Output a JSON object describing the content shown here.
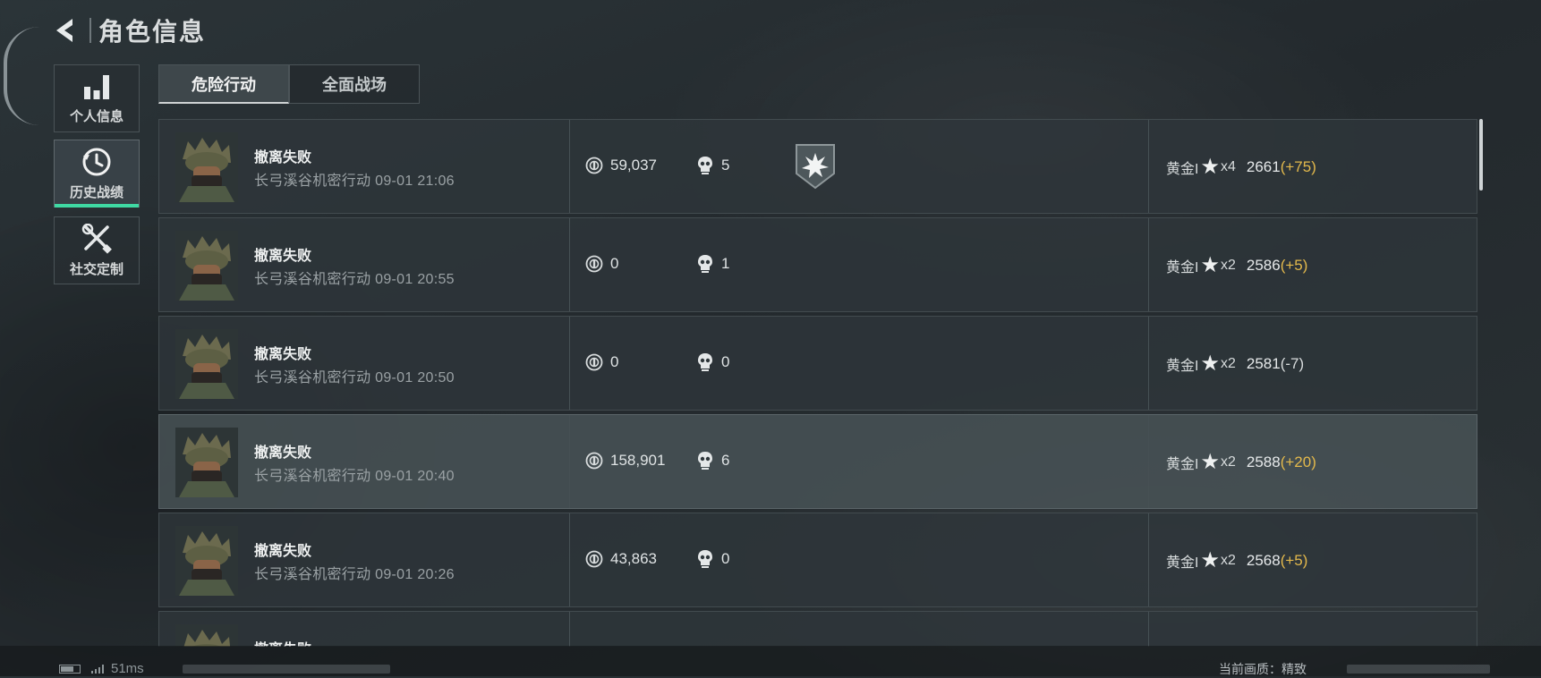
{
  "header": {
    "title": "角色信息"
  },
  "sidebar": {
    "items": [
      {
        "label": "个人信息",
        "icon": "bar-chart-icon"
      },
      {
        "label": "历史战绩",
        "icon": "history-clock-icon",
        "active": true
      },
      {
        "label": "社交定制",
        "icon": "tools-icon"
      }
    ]
  },
  "tabs": [
    {
      "label": "危险行动",
      "active": true
    },
    {
      "label": "全面战场",
      "active": false
    }
  ],
  "matches": [
    {
      "result": "撤离失败",
      "detail": "长弓溪谷机密行动 09-01 21:06",
      "coins": "59,037",
      "kills": "5",
      "badge": "explosion-shield-icon",
      "rank": "黄金I",
      "stars": "x4",
      "score": "2661",
      "delta": "(+75)",
      "delta_color": "#e3b94c"
    },
    {
      "result": "撤离失败",
      "detail": "长弓溪谷机密行动 09-01 20:55",
      "coins": "0",
      "kills": "1",
      "rank": "黄金I",
      "stars": "x2",
      "score": "2586",
      "delta": "(+5)",
      "delta_color": "#e3b94c"
    },
    {
      "result": "撤离失败",
      "detail": "长弓溪谷机密行动 09-01 20:50",
      "coins": "0",
      "kills": "0",
      "rank": "黄金I",
      "stars": "x2",
      "score": "2581",
      "delta": "(-7)",
      "delta_color": "#d7dbdc"
    },
    {
      "result": "撤离失败",
      "detail": "长弓溪谷机密行动 09-01 20:40",
      "coins": "158,901",
      "kills": "6",
      "rank": "黄金I",
      "stars": "x2",
      "score": "2588",
      "delta": "(+20)",
      "delta_color": "#e3b94c"
    },
    {
      "result": "撤离失败",
      "detail": "长弓溪谷机密行动 09-01 20:26",
      "coins": "43,863",
      "kills": "0",
      "rank": "黄金I",
      "stars": "x2",
      "score": "2568",
      "delta": "(+5)",
      "delta_color": "#e3b94c"
    },
    {
      "result": "撤离失败"
    }
  ],
  "status": {
    "ping": "51ms",
    "quality": "当前画质：精致"
  },
  "colors": {
    "accent": "#3fd9a3",
    "gain": "#e3b94c"
  }
}
